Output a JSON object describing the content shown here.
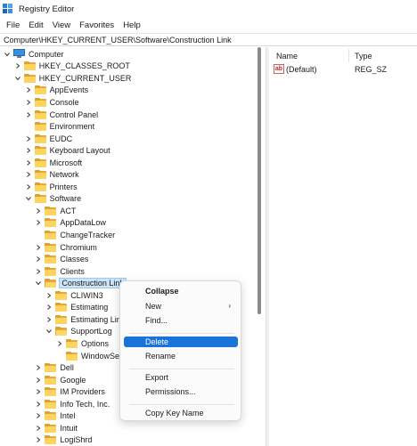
{
  "window": {
    "title": "Registry Editor"
  },
  "menu": [
    "File",
    "Edit",
    "View",
    "Favorites",
    "Help"
  ],
  "address": "Computer\\HKEY_CURRENT_USER\\Software\\Construction Link",
  "tree": [
    {
      "label": "Computer",
      "icon": "computer-icon",
      "chevron": "down",
      "indent": 0
    },
    {
      "label": "HKEY_CLASSES_ROOT",
      "icon": "folder-icon",
      "chevron": "right",
      "indent": 1
    },
    {
      "label": "HKEY_CURRENT_USER",
      "icon": "folder-icon",
      "chevron": "down",
      "indent": 1
    },
    {
      "label": "AppEvents",
      "icon": "folder-icon",
      "chevron": "right",
      "indent": 2
    },
    {
      "label": "Console",
      "icon": "folder-icon",
      "chevron": "right",
      "indent": 2
    },
    {
      "label": "Control Panel",
      "icon": "folder-icon",
      "chevron": "right",
      "indent": 2
    },
    {
      "label": "Environment",
      "icon": "folder-icon",
      "chevron": "none",
      "indent": 2
    },
    {
      "label": "EUDC",
      "icon": "folder-icon",
      "chevron": "right",
      "indent": 2
    },
    {
      "label": "Keyboard Layout",
      "icon": "folder-icon",
      "chevron": "right",
      "indent": 2
    },
    {
      "label": "Microsoft",
      "icon": "folder-icon",
      "chevron": "right",
      "indent": 2
    },
    {
      "label": "Network",
      "icon": "folder-icon",
      "chevron": "right",
      "indent": 2
    },
    {
      "label": "Printers",
      "icon": "folder-icon",
      "chevron": "right",
      "indent": 2
    },
    {
      "label": "Software",
      "icon": "folder-icon",
      "chevron": "down",
      "indent": 2
    },
    {
      "label": "ACT",
      "icon": "folder-icon",
      "chevron": "right",
      "indent": 3
    },
    {
      "label": "AppDataLow",
      "icon": "folder-icon",
      "chevron": "right",
      "indent": 3
    },
    {
      "label": "ChangeTracker",
      "icon": "folder-icon",
      "chevron": "none",
      "indent": 3
    },
    {
      "label": "Chromium",
      "icon": "folder-icon",
      "chevron": "right",
      "indent": 3
    },
    {
      "label": "Classes",
      "icon": "folder-icon",
      "chevron": "right",
      "indent": 3
    },
    {
      "label": "Clients",
      "icon": "folder-icon",
      "chevron": "right",
      "indent": 3
    },
    {
      "label": "Construction Link",
      "icon": "folder-open-icon",
      "chevron": "down",
      "indent": 3,
      "selected": true
    },
    {
      "label": "CLIWIN3",
      "icon": "folder-icon",
      "chevron": "right",
      "indent": 4
    },
    {
      "label": "Estimating",
      "icon": "folder-icon",
      "chevron": "right",
      "indent": 4
    },
    {
      "label": "Estimating Lin",
      "icon": "folder-icon",
      "chevron": "right",
      "indent": 4
    },
    {
      "label": "SupportLog",
      "icon": "folder-open-icon",
      "chevron": "down",
      "indent": 4
    },
    {
      "label": "Options",
      "icon": "folder-icon",
      "chevron": "right",
      "indent": 5
    },
    {
      "label": "WindowSe",
      "icon": "folder-icon",
      "chevron": "none",
      "indent": 5
    },
    {
      "label": "Dell",
      "icon": "folder-icon",
      "chevron": "right",
      "indent": 3
    },
    {
      "label": "Google",
      "icon": "folder-icon",
      "chevron": "right",
      "indent": 3
    },
    {
      "label": "IM Providers",
      "icon": "folder-icon",
      "chevron": "right",
      "indent": 3
    },
    {
      "label": "Info Tech, Inc.",
      "icon": "folder-icon",
      "chevron": "right",
      "indent": 3
    },
    {
      "label": "Intel",
      "icon": "folder-icon",
      "chevron": "right",
      "indent": 3
    },
    {
      "label": "Intuit",
      "icon": "folder-icon",
      "chevron": "right",
      "indent": 3
    },
    {
      "label": "LogiShrd",
      "icon": "folder-icon",
      "chevron": "right",
      "indent": 3
    }
  ],
  "values": {
    "headers": {
      "name": "Name",
      "type": "Type"
    },
    "rows": [
      {
        "icon": "string-value-icon",
        "icon_text": "ab",
        "name": "(Default)",
        "type": "REG_SZ"
      }
    ]
  },
  "context_menu": [
    {
      "label": "Collapse",
      "bold": true
    },
    {
      "label": "New",
      "submenu": true,
      "arrow": "›"
    },
    {
      "label": "Find..."
    },
    {
      "separator": true
    },
    {
      "label": "Delete",
      "highlighted": true
    },
    {
      "label": "Rename"
    },
    {
      "separator": true
    },
    {
      "label": "Export"
    },
    {
      "label": "Permissions..."
    },
    {
      "separator": true
    },
    {
      "label": "Copy Key Name"
    }
  ],
  "colors": {
    "selection": "#cce4f7",
    "menu_highlight": "#1a73d9",
    "folder": "#fcd45e"
  }
}
